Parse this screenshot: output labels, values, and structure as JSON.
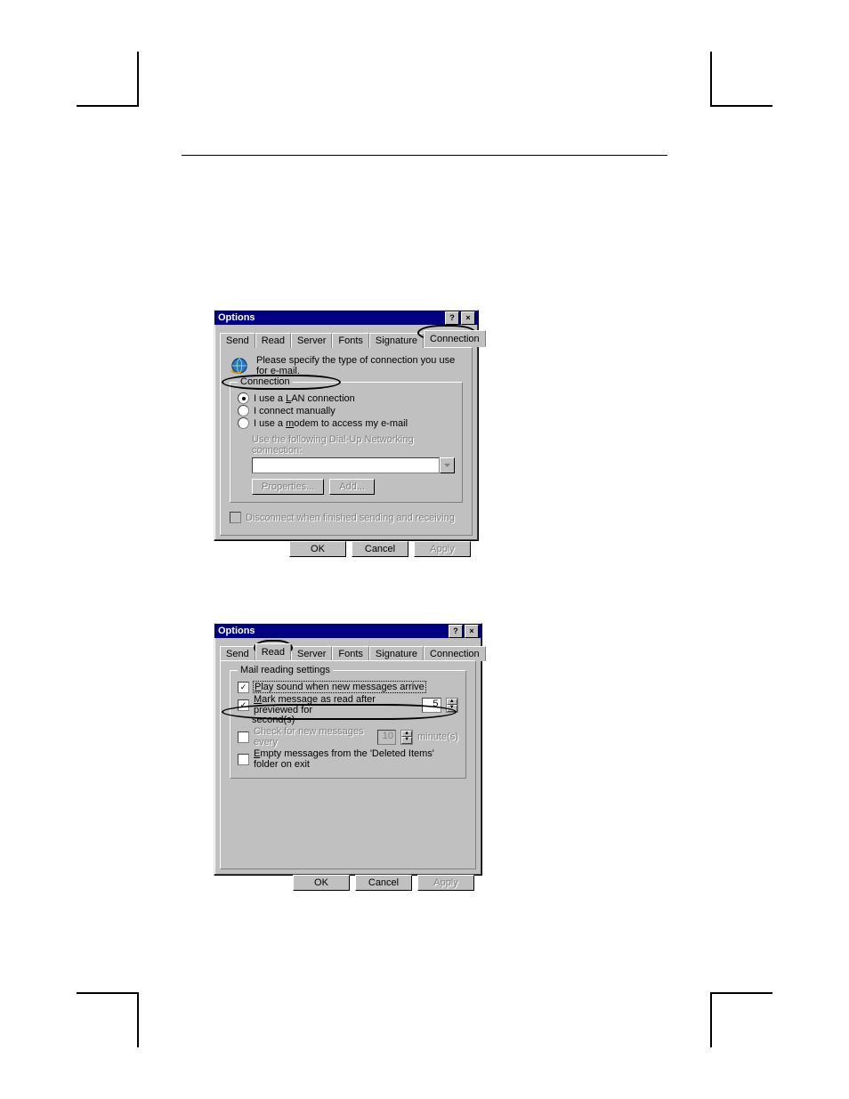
{
  "dialog1": {
    "title": "Options",
    "titlebar": {
      "help": "?",
      "close": "×"
    },
    "tabs": {
      "send": "Send",
      "read": "Read",
      "server": "Server",
      "fonts": "Fonts",
      "signature": "Signature",
      "connection": "Connection"
    },
    "header_text": "Please specify the type of connection you use for e-mail.",
    "group_legend": "Connection",
    "radio": {
      "lan": "I use a LAN connection",
      "manual": "I connect manually",
      "modem": "I use a modem to access my e-mail"
    },
    "dialup_label": "Use the following Dial-Up Networking connection:",
    "btn_properties": "Properties...",
    "btn_add": "Add...",
    "chk_disconnect": "Disconnect when finished sending and receiving",
    "btn_ok": "OK",
    "btn_cancel": "Cancel",
    "btn_apply": "Apply"
  },
  "dialog2": {
    "title": "Options",
    "titlebar": {
      "help": "?",
      "close": "×"
    },
    "tabs": {
      "send": "Send",
      "read": "Read",
      "server": "Server",
      "fonts": "Fonts",
      "signature": "Signature",
      "connection": "Connection"
    },
    "group_legend": "Mail reading settings",
    "chk_play": "Play sound when new messages arrive",
    "chk_mark_pre": "Mark message as read after previewed for",
    "mark_value": "5",
    "mark_post": "second(s)",
    "chk_check_pre": "Check for new messages every",
    "check_value": "10",
    "chk_check_post": "minute(s)",
    "chk_empty": "Empty messages from the 'Deleted Items' folder on exit",
    "btn_ok": "OK",
    "btn_cancel": "Cancel",
    "btn_apply": "Apply"
  }
}
